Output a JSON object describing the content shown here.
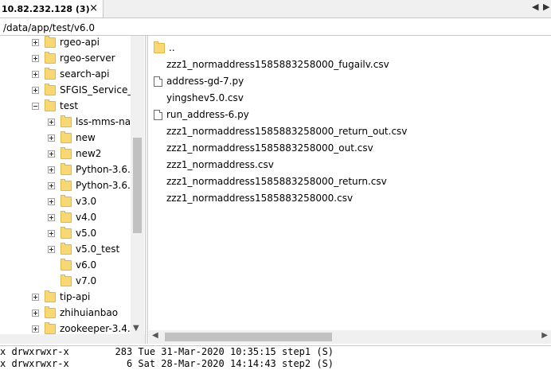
{
  "tab": {
    "title": "10.82.232.128 (3)",
    "close": "×"
  },
  "nav": {
    "left": "◀",
    "right": "▶"
  },
  "path": "/data/app/test/v6.0",
  "tree": [
    {
      "label": "rgeo-api",
      "level": 0
    },
    {
      "label": "rgeo-server",
      "level": 0
    },
    {
      "label": "search-api",
      "level": 0
    },
    {
      "label": "SFGIS_Service_I",
      "level": 0
    },
    {
      "label": "test",
      "level": 0,
      "expanded": true
    },
    {
      "label": "lss-mms-na",
      "level": 1
    },
    {
      "label": "new",
      "level": 1
    },
    {
      "label": "new2",
      "level": 1
    },
    {
      "label": "Python-3.6.0",
      "level": 1
    },
    {
      "label": "Python-3.6.2",
      "level": 1
    },
    {
      "label": "v3.0",
      "level": 1
    },
    {
      "label": "v4.0",
      "level": 1
    },
    {
      "label": "v5.0",
      "level": 1
    },
    {
      "label": "v5.0_test",
      "level": 1
    },
    {
      "label": "v6.0",
      "level": 1,
      "noexpander": true
    },
    {
      "label": "v7.0",
      "level": 1,
      "noexpander": true
    },
    {
      "label": "tip-api",
      "level": 0
    },
    {
      "label": "zhihuianbao",
      "level": 0
    },
    {
      "label": "zookeeper-3.4.",
      "level": 0
    }
  ],
  "files": [
    {
      "name": "..",
      "icon": "folder"
    },
    {
      "name": "zzz1_normaddress1585883258000_fugailv.csv",
      "icon": "none"
    },
    {
      "name": "address-gd-7.py",
      "icon": "doc"
    },
    {
      "name": "yingshev5.0.csv",
      "icon": "none"
    },
    {
      "name": "run_address-6.py",
      "icon": "doc"
    },
    {
      "name": "zzz1_normaddress1585883258000_return_out.csv",
      "icon": "none"
    },
    {
      "name": "zzz1_normaddress1585883258000_out.csv",
      "icon": "none"
    },
    {
      "name": "zzz1_normaddress.csv",
      "icon": "none"
    },
    {
      "name": "zzz1_normaddress1585883258000_return.csv",
      "icon": "none"
    },
    {
      "name": "zzz1_normaddress1585883258000.csv",
      "icon": "none"
    }
  ],
  "terminal": [
    "x drwxrwxr-x        283 Tue 31-Mar-2020 10:35:15 step1 (S)",
    "x drwxrwxr-x          6 Sat 28-Mar-2020 14:14:43 step2 (S)"
  ],
  "scroll": {
    "down": "▼",
    "left": "◀",
    "right": "▶"
  }
}
